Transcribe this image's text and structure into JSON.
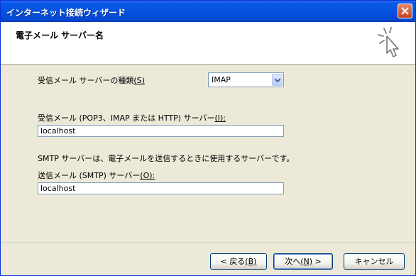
{
  "window": {
    "title": "インターネット接続ウィザード"
  },
  "header": {
    "title": "電子メール サーバー名"
  },
  "icons": {
    "close": "close-icon",
    "wizard": "wizard-sparkle-icon",
    "dropdown": "chevron-down-icon"
  },
  "colors": {
    "titlebar": "#0453e0",
    "background": "#ece9d8",
    "header_bg": "#ffffff",
    "input_border": "#7f9db9"
  },
  "form": {
    "server_type_label": "受信メール サーバーの種類",
    "server_type_accel": "(S)",
    "server_type_value": "IMAP",
    "incoming_label": "受信メール (POP3、IMAP または HTTP) サーバー",
    "incoming_accel": "(I):",
    "incoming_value": "localhost",
    "smtp_description": "SMTP サーバーは、電子メールを送信するときに使用するサーバーです。",
    "outgoing_label": "送信メール (SMTP) サーバー",
    "outgoing_accel": "(O):",
    "outgoing_value": "localhost"
  },
  "buttons": {
    "back_label": "< 戻る",
    "back_accel": "(B)",
    "next_label": "次へ",
    "next_accel": "(N)",
    "next_suffix": " >",
    "cancel_label": "キャンセル"
  }
}
